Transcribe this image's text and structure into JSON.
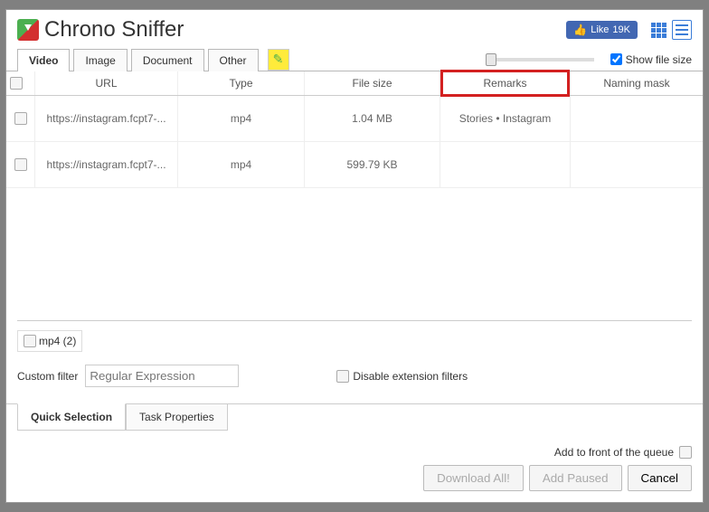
{
  "app": {
    "title_bold": "Chrono",
    "title_light": "Sniffer"
  },
  "like": {
    "label": "Like",
    "count": "19K"
  },
  "show_file_size_label": "Show file size",
  "tabs": {
    "video": "Video",
    "image": "Image",
    "document": "Document",
    "other": "Other"
  },
  "columns": {
    "url": "URL",
    "type": "Type",
    "size": "File size",
    "remarks": "Remarks",
    "naming": "Naming mask"
  },
  "rows": [
    {
      "url": "https://instagram.fcpt7-...",
      "type": "mp4",
      "size": "1.04 MB",
      "remarks": "Stories • Instagram"
    },
    {
      "url": "https://instagram.fcpt7-...",
      "type": "mp4",
      "size": "599.79 KB",
      "remarks": ""
    }
  ],
  "filter": {
    "type_label": "mp4 (2)",
    "custom_label": "Custom filter",
    "placeholder": "Regular Expression",
    "disable_label": "Disable extension filters"
  },
  "bottom_tabs": {
    "quick": "Quick Selection",
    "task": "Task Properties"
  },
  "footer": {
    "front_queue": "Add to front of the queue",
    "download_all": "Download All!",
    "add_paused": "Add Paused",
    "cancel": "Cancel"
  }
}
